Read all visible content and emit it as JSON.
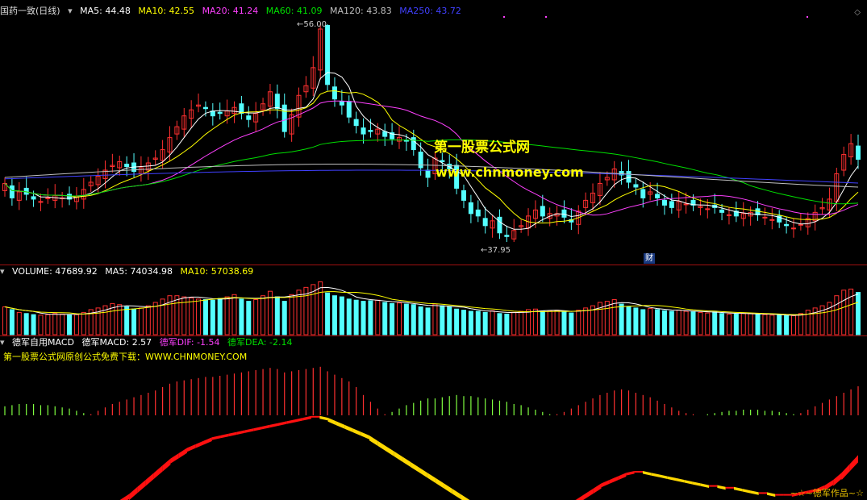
{
  "main_header": {
    "title": "国药一致(日线)",
    "ma5": "MA5: 44.48",
    "ma10": "MA10: 42.55",
    "ma20": "MA20: 41.24",
    "ma60": "MA60: 41.09",
    "ma120": "MA120: 43.83",
    "ma250": "MA250: 43.72"
  },
  "annotations": {
    "high": "56.00",
    "low": "37.95",
    "fin_badge": "财"
  },
  "watermark": {
    "name": "第一股票公式网",
    "url": "www.chnmoney.com"
  },
  "volume_header": {
    "label": "VOLUME: 47689.92",
    "ma5": "MA5: 74034.98",
    "ma10": "MA10: 57038.69"
  },
  "macd_header": {
    "title": "德军自用MACD",
    "macd": "德军MACD: 2.57",
    "dif": "德军DIF: -1.54",
    "dea": "德军DEA: -2.14",
    "note": "第一股票公式网原创公式免费下载：WWW.CHNMONEY.COM"
  },
  "signature": "~☆~德军作品~☆",
  "colors": {
    "up": "#ff3030",
    "down": "#54ffff",
    "ma5": "#ffffff",
    "ma10": "#ffff00",
    "ma20": "#ff40ff",
    "ma60": "#00e000",
    "ma120": "#c0c0c0",
    "ma250": "#4040ff",
    "dif": "#ff40ff",
    "dea": "#00e000",
    "divider": "#a01010"
  },
  "chart_data": {
    "type": "candlestick",
    "price_range": [
      37.95,
      56.0
    ],
    "closes": [
      42.8,
      41.6,
      42.1,
      41.9,
      41.5,
      41.3,
      41.6,
      41.8,
      41.6,
      41.5,
      41.7,
      42.3,
      42.9,
      43.4,
      43.9,
      44.3,
      44.6,
      44.2,
      43.8,
      44.1,
      44.5,
      44.9,
      45.6,
      46.6,
      47.5,
      48.4,
      48.9,
      49.3,
      49.0,
      48.4,
      48.6,
      48.8,
      49.1,
      48.6,
      48.1,
      48.6,
      49.4,
      50.4,
      49.0,
      47.1,
      48.5,
      50.1,
      50.9,
      52.4,
      55.6,
      51.0,
      49.8,
      49.3,
      48.3,
      47.6,
      46.9,
      47.1,
      47.3,
      46.7,
      46.5,
      46.6,
      46.3,
      45.6,
      44.1,
      43.3,
      44.9,
      44.6,
      44.0,
      42.4,
      41.4,
      40.3,
      40.1,
      39.3,
      39.7,
      38.7,
      38.4,
      38.9,
      39.3,
      40.1,
      40.6,
      40.1,
      40.3,
      40.3,
      40.0,
      39.6,
      40.5,
      41.4,
      42.0,
      42.8,
      43.3,
      44.0,
      43.5,
      42.9,
      42.5,
      41.6,
      42.1,
      41.6,
      41.0,
      40.8,
      41.3,
      41.1,
      41.0,
      40.9,
      40.7,
      40.8,
      40.4,
      40.2,
      40.1,
      40.3,
      40.4,
      40.2,
      40.0,
      39.8,
      39.6,
      39.3,
      39.1,
      39.4,
      39.9,
      40.4,
      40.8,
      41.5,
      43.6,
      45.2,
      46.1,
      44.8
    ],
    "volumes": [
      50,
      45,
      40,
      38,
      36,
      35,
      36,
      38,
      37,
      36,
      36,
      40,
      45,
      48,
      52,
      56,
      54,
      50,
      46,
      48,
      52,
      58,
      64,
      70,
      70,
      68,
      66,
      64,
      63,
      62,
      65,
      68,
      72,
      64,
      60,
      63,
      70,
      78,
      68,
      60,
      72,
      80,
      85,
      90,
      95,
      75,
      70,
      68,
      64,
      62,
      60,
      61,
      62,
      58,
      56,
      57,
      55,
      54,
      50,
      48,
      55,
      52,
      50,
      46,
      44,
      42,
      42,
      40,
      43,
      38,
      37,
      40,
      42,
      45,
      46,
      42,
      43,
      44,
      41,
      39,
      44,
      48,
      52,
      58,
      60,
      63,
      55,
      50,
      48,
      45,
      47,
      45,
      43,
      42,
      44,
      42,
      41,
      40,
      39,
      41,
      38,
      37,
      37,
      38,
      38,
      37,
      36,
      35,
      35,
      34,
      34,
      38,
      44,
      48,
      52,
      58,
      70,
      80,
      82,
      76
    ],
    "macd_hist": [
      -0.8,
      -0.9,
      -1.0,
      -1.0,
      -1.0,
      -0.9,
      -0.9,
      -0.8,
      -0.7,
      -0.6,
      -0.4,
      -0.2,
      0.1,
      0.4,
      0.7,
      1.0,
      1.2,
      1.4,
      1.6,
      1.8,
      2.0,
      2.2,
      2.5,
      2.8,
      3.0,
      3.1,
      3.2,
      3.3,
      3.4,
      3.4,
      3.5,
      3.6,
      3.7,
      3.8,
      3.9,
      4.0,
      4.1,
      4.2,
      4.1,
      3.8,
      3.9,
      4.0,
      4.1,
      4.2,
      4.3,
      3.9,
      3.6,
      3.3,
      3.0,
      2.5,
      1.8,
      1.2,
      0.6,
      0.1,
      -0.3,
      -0.6,
      -0.9,
      -1.1,
      -1.3,
      -1.5,
      -1.5,
      -1.6,
      -1.7,
      -1.8,
      -1.7,
      -1.7,
      -1.6,
      -1.5,
      -1.4,
      -1.3,
      -1.2,
      -1.0,
      -0.9,
      -0.7,
      -0.5,
      -0.3,
      -0.1,
      0.1,
      0.3,
      0.6,
      0.9,
      1.2,
      1.5,
      1.8,
      2.0,
      2.2,
      2.3,
      2.2,
      2.0,
      1.8,
      1.6,
      1.3,
      1.0,
      0.7,
      0.4,
      0.2,
      0.1,
      0.0,
      -0.1,
      -0.2,
      -0.3,
      -0.4,
      -0.4,
      -0.5,
      -0.5,
      -0.5,
      -0.4,
      -0.4,
      -0.3,
      -0.2,
      -0.1,
      0.2,
      0.5,
      0.8,
      1.1,
      1.4,
      1.7,
      2.0,
      2.3,
      2.57
    ],
    "dif_band": [
      -1.6,
      -1.7,
      -1.8,
      -1.9,
      -2.0,
      -2.1,
      -2.1,
      -2.2,
      -2.2,
      -2.1,
      -2.0,
      -1.9,
      -1.7,
      -1.4,
      -1.1,
      -0.8,
      -0.4,
      0.0,
      0.4,
      0.8,
      1.2,
      1.5,
      1.8,
      2.0,
      2.2,
      2.4,
      2.5,
      2.6,
      2.7,
      2.8,
      2.9,
      3.0,
      3.1,
      3.2,
      3.3,
      3.4,
      3.5,
      3.6,
      3.6,
      3.5,
      3.3,
      3.1,
      2.9,
      2.7,
      2.5,
      2.2,
      1.9,
      1.6,
      1.3,
      1.0,
      0.7,
      0.4,
      0.1,
      -0.2,
      -0.5,
      -0.8,
      -1.1,
      -1.4,
      -1.6,
      -1.8,
      -2.0,
      -2.1,
      -2.2,
      -2.2,
      -2.1,
      -2.0,
      -1.8,
      -1.6,
      -1.4,
      -1.1,
      -0.8,
      -0.5,
      -0.2,
      0.0,
      0.2,
      0.4,
      0.5,
      0.5,
      0.4,
      0.3,
      0.2,
      0.1,
      0.0,
      -0.1,
      -0.2,
      -0.3,
      -0.3,
      -0.4,
      -0.4,
      -0.5,
      -0.6,
      -0.7,
      -0.7,
      -0.8,
      -0.8,
      -0.8,
      -0.7,
      -0.6,
      -0.5,
      -0.3,
      0.0,
      0.4,
      0.9,
      1.4
    ],
    "ylabels_in_view": [
      "56.00",
      "37.95"
    ]
  }
}
